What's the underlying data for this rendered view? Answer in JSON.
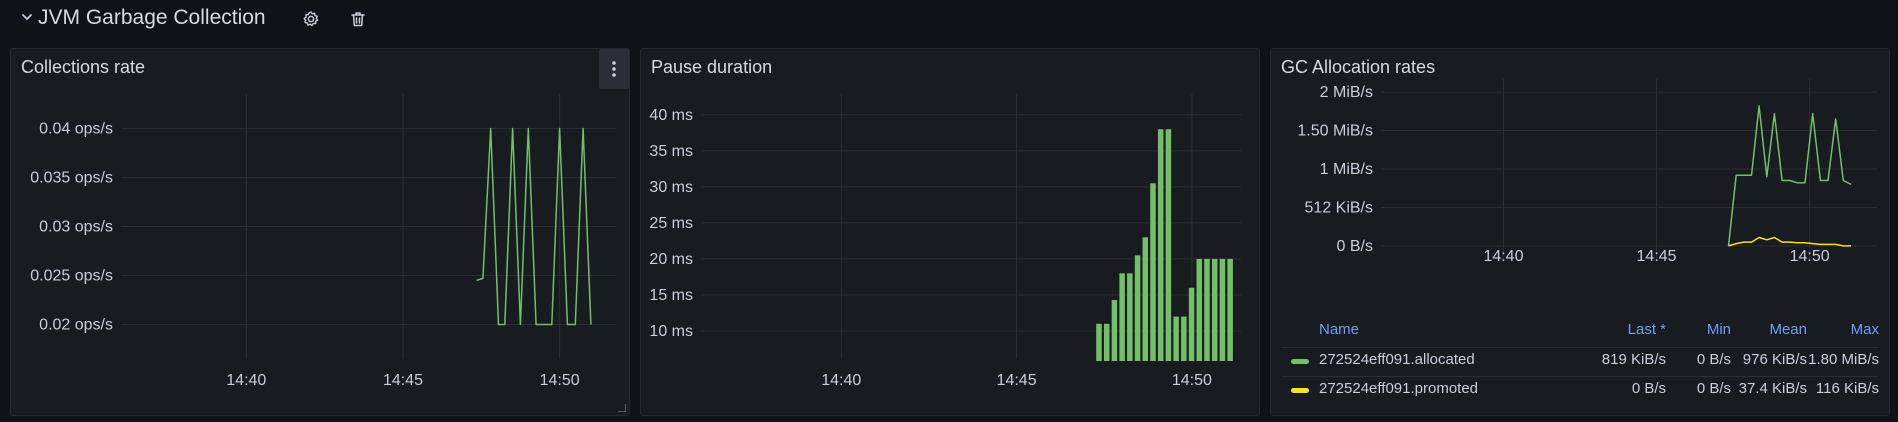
{
  "row": {
    "title": "JVM Garbage Collection",
    "icons": [
      "chevron-down-icon",
      "gear-icon",
      "trash-icon"
    ]
  },
  "panels": {
    "collections": {
      "title": "Collections rate"
    },
    "pause": {
      "title": "Pause duration"
    },
    "alloc": {
      "title": "GC Allocation rates",
      "legend": {
        "headers": [
          "Name",
          "Last *",
          "Min",
          "Mean",
          "Max"
        ],
        "rows": [
          {
            "name": "272524eff091.allocated",
            "last": "819 KiB/s",
            "min": "0 B/s",
            "mean": "976 KiB/s",
            "max": "1.80 MiB/s",
            "color": "#73bf69"
          },
          {
            "name": "272524eff091.promoted",
            "last": "0 B/s",
            "min": "0 B/s",
            "mean": "37.4 KiB/s",
            "max": "116 KiB/s",
            "color": "#fade2a"
          }
        ]
      }
    }
  },
  "chart_data": [
    {
      "type": "line",
      "title": "Collections rate",
      "xlim": [
        36.0,
        51.8
      ],
      "ylim": [
        0.0175,
        0.0425
      ],
      "y_ticks": [
        0.02,
        0.025,
        0.03,
        0.035,
        0.04
      ],
      "y_tick_labels": [
        "0.02 ops/s",
        "0.025 ops/s",
        "0.03 ops/s",
        "0.035 ops/s",
        "0.04 ops/s"
      ],
      "x_ticks": [
        40,
        45,
        50
      ],
      "x_tick_labels": [
        "14:40",
        "14:45",
        "14:50"
      ],
      "series": [
        {
          "color": "#73bf69",
          "x": [
            47.35,
            47.55,
            47.8,
            48.05,
            48.25,
            48.5,
            48.75,
            49.0,
            49.25,
            49.5,
            49.75,
            50.0,
            50.25,
            50.5,
            50.75,
            51.0
          ],
          "y": [
            0.0245,
            0.0247,
            0.04,
            0.02,
            0.02,
            0.04,
            0.02,
            0.04,
            0.02,
            0.02,
            0.02,
            0.04,
            0.02,
            0.02,
            0.04,
            0.02
          ]
        }
      ]
    },
    {
      "type": "bar",
      "title": "Pause duration",
      "xlim": [
        36.0,
        51.4
      ],
      "ylim": [
        7.5,
        41.5
      ],
      "y_ticks": [
        10,
        15,
        20,
        25,
        30,
        35,
        40
      ],
      "y_tick_labels": [
        "10 ms",
        "15 ms",
        "20 ms",
        "25 ms",
        "30 ms",
        "35 ms",
        "40 ms"
      ],
      "x_ticks": [
        40,
        45,
        50
      ],
      "x_tick_labels": [
        "14:40",
        "14:45",
        "14:50"
      ],
      "series": [
        {
          "color": "#73bf69",
          "x": [
            47.35,
            47.57,
            47.79,
            48.01,
            48.23,
            48.45,
            48.67,
            48.89,
            49.11,
            49.33,
            49.55,
            49.77,
            49.99,
            50.21,
            50.43,
            50.65,
            50.87,
            51.09
          ],
          "values": [
            11,
            11,
            14.3,
            18,
            18,
            20.5,
            23,
            30.5,
            38,
            38,
            12,
            12,
            16,
            20,
            20,
            20,
            20,
            20
          ]
        }
      ]
    },
    {
      "type": "line",
      "title": "GC Allocation rates",
      "xlim": [
        36.0,
        52.2
      ],
      "ylim": [
        -0.04,
        2.04
      ],
      "y_ticks": [
        0,
        0.5,
        1.0,
        1.5,
        2.0
      ],
      "y_tick_labels": [
        "0 B/s",
        "512 KiB/s",
        "1 MiB/s",
        "1.50 MiB/s",
        "2 MiB/s"
      ],
      "x_ticks": [
        40,
        45,
        50
      ],
      "x_tick_labels": [
        "14:40",
        "14:45",
        "14:50"
      ],
      "series": [
        {
          "name": "272524eff091.allocated",
          "color": "#73bf69",
          "x": [
            47.35,
            47.6,
            47.85,
            48.1,
            48.35,
            48.6,
            48.85,
            49.1,
            49.35,
            49.6,
            49.85,
            50.1,
            50.35,
            50.6,
            50.85,
            51.1,
            51.35
          ],
          "y": [
            0,
            0.92,
            0.92,
            0.92,
            1.82,
            0.9,
            1.72,
            0.85,
            0.85,
            0.82,
            0.82,
            1.72,
            0.85,
            0.85,
            1.65,
            0.85,
            0.8
          ]
        },
        {
          "name": "272524eff091.promoted",
          "color": "#fade2a",
          "x": [
            47.35,
            47.6,
            47.85,
            48.1,
            48.35,
            48.6,
            48.85,
            49.1,
            49.35,
            49.6,
            49.85,
            50.1,
            50.35,
            50.6,
            50.85,
            51.1,
            51.35
          ],
          "y": [
            0,
            0.03,
            0.05,
            0.05,
            0.11,
            0.08,
            0.11,
            0.05,
            0.05,
            0.04,
            0.04,
            0.03,
            0.02,
            0.02,
            0.02,
            0.0,
            0.0
          ]
        }
      ]
    }
  ]
}
